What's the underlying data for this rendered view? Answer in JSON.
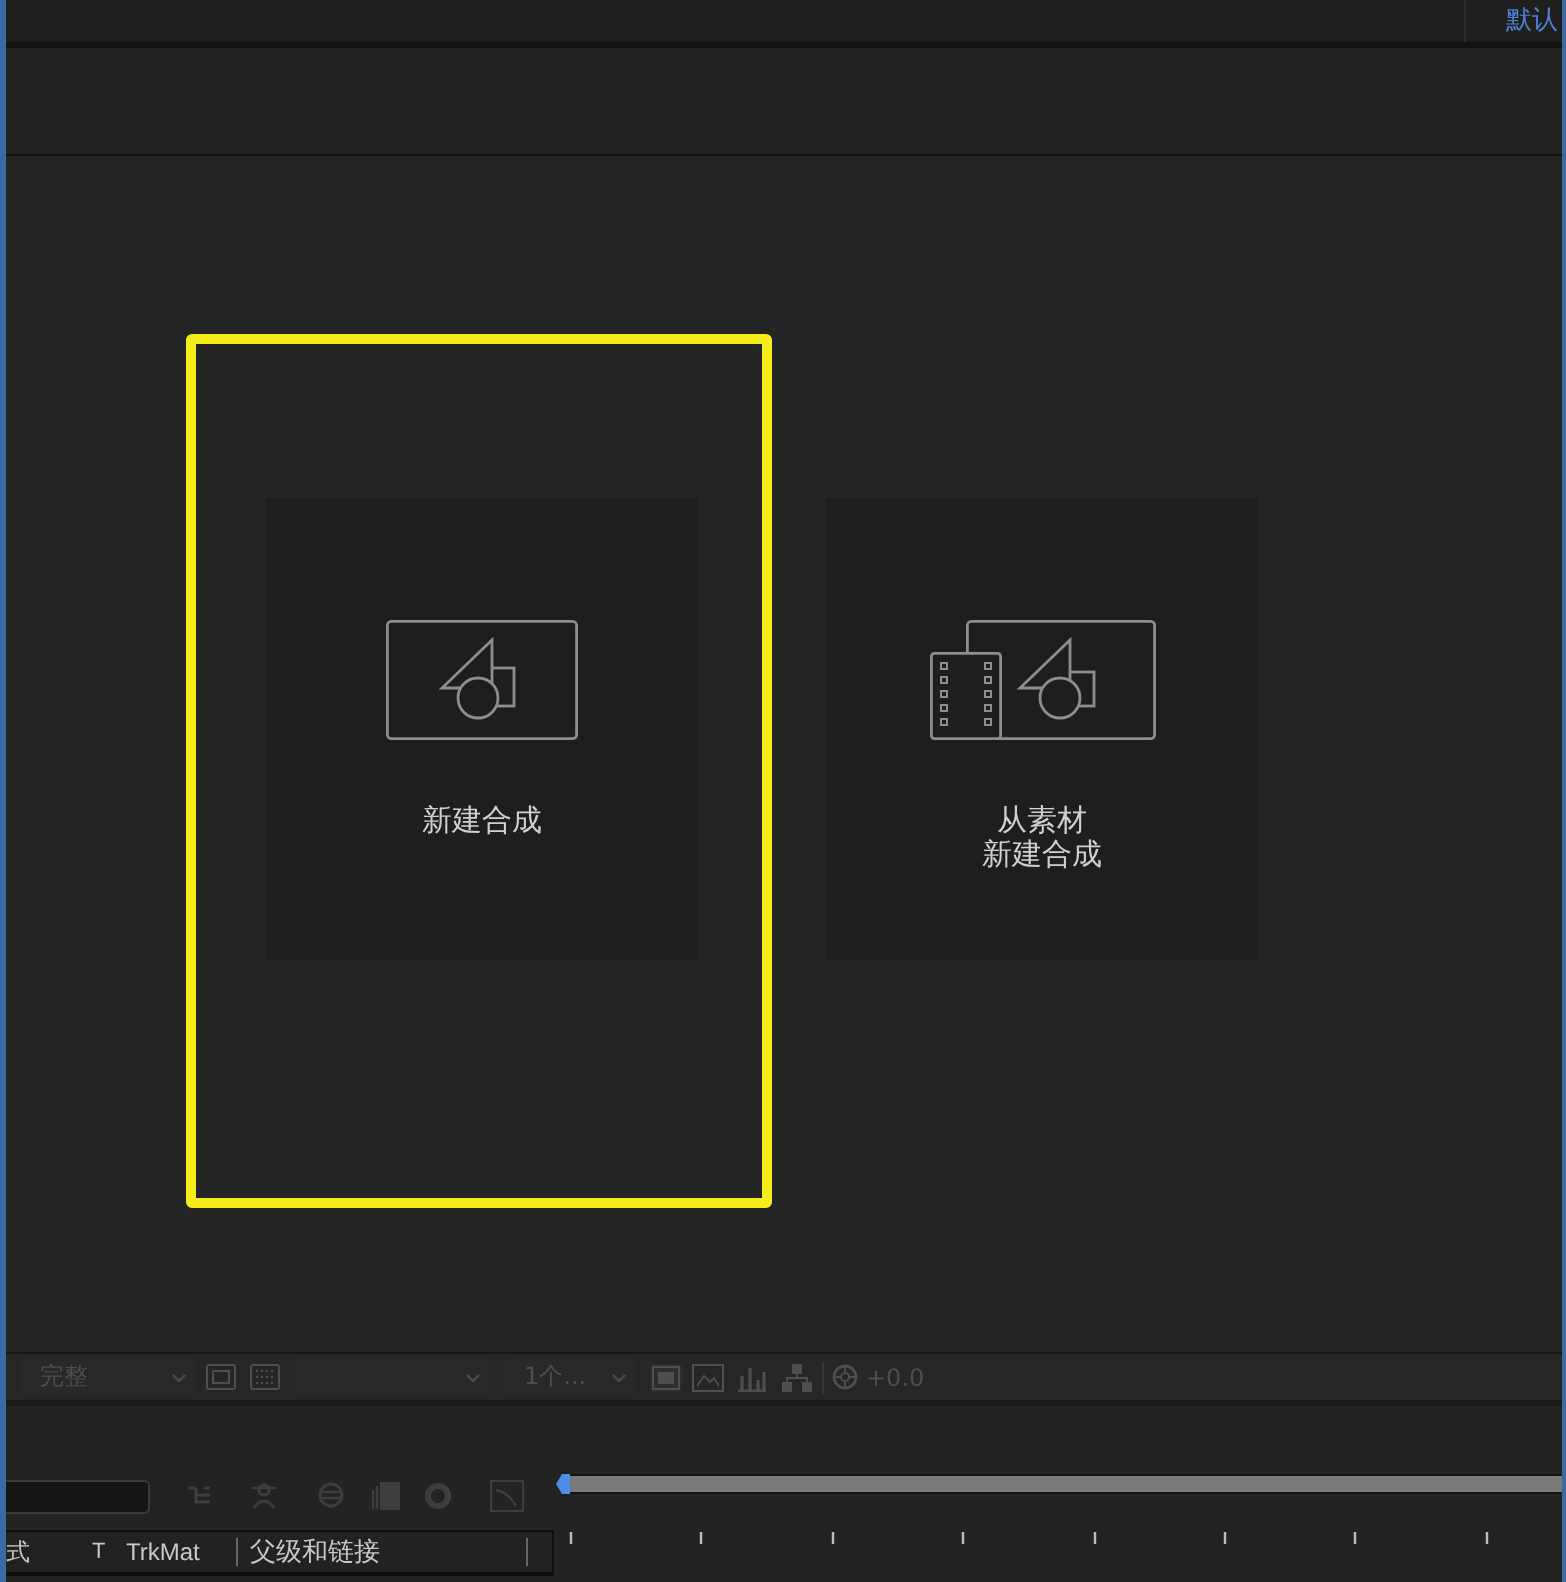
{
  "top_bar": {
    "workspaces": [
      {
        "label": "默认",
        "selected": true
      }
    ]
  },
  "composition_panel": {
    "cards": [
      {
        "kind": "new-composition",
        "label_lines": [
          "新建合成"
        ],
        "highlighted": true
      },
      {
        "kind": "from-footage",
        "label_lines": [
          "从素材",
          "新建合成"
        ],
        "highlighted": false
      }
    ]
  },
  "viewer_toolbar": {
    "disabled": true,
    "resolution": "完整",
    "views": "1个...",
    "exposure": "+0.0"
  },
  "timeline": {
    "columns": [
      "式",
      "T",
      "TrkMat",
      "父级和链接"
    ]
  }
}
